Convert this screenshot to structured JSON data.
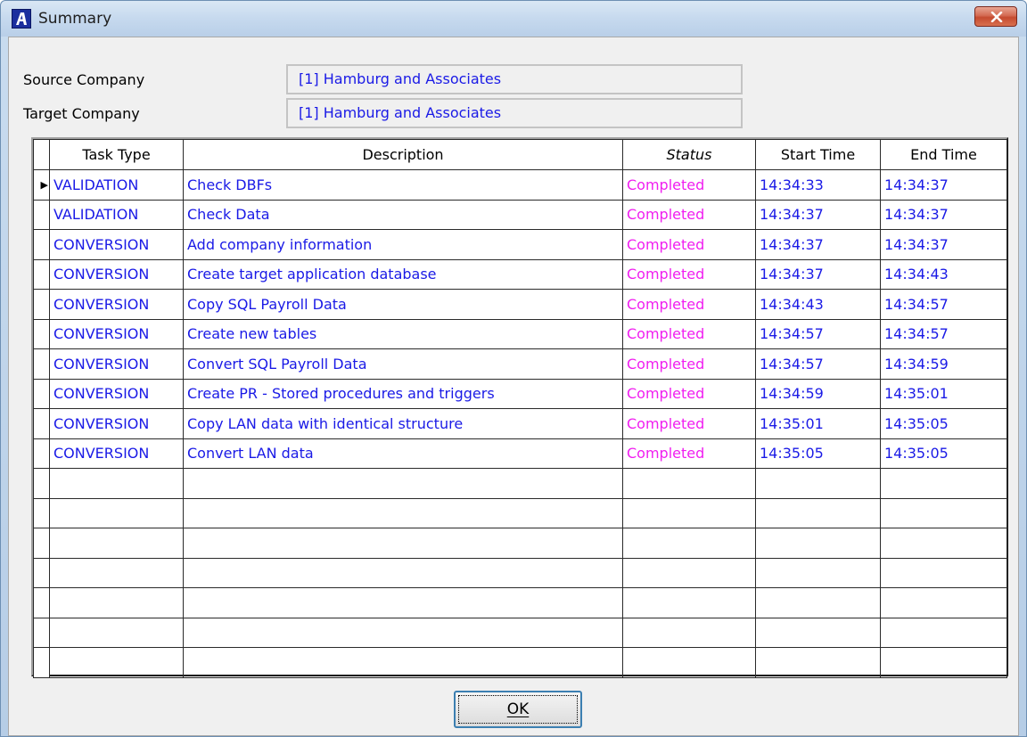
{
  "window": {
    "title": "Summary",
    "app_icon": "A"
  },
  "fields": {
    "source_label": "Source Company",
    "source_value": "[1] Hamburg and Associates",
    "target_label": "Target Company",
    "target_value": "[1] Hamburg and Associates"
  },
  "grid": {
    "headers": [
      "Task Type",
      "Description",
      "Status",
      "Start Time",
      "End Time"
    ],
    "rows": [
      {
        "type": "VALIDATION",
        "desc": "Check DBFs",
        "status": "Completed",
        "start": "14:34:33",
        "end": "14:34:37"
      },
      {
        "type": "VALIDATION",
        "desc": "Check Data",
        "status": "Completed",
        "start": "14:34:37",
        "end": "14:34:37"
      },
      {
        "type": "CONVERSION",
        "desc": "Add company information",
        "status": "Completed",
        "start": "14:34:37",
        "end": "14:34:37"
      },
      {
        "type": "CONVERSION",
        "desc": "Create target application database",
        "status": "Completed",
        "start": "14:34:37",
        "end": "14:34:43"
      },
      {
        "type": "CONVERSION",
        "desc": "Copy SQL Payroll Data",
        "status": "Completed",
        "start": "14:34:43",
        "end": "14:34:57"
      },
      {
        "type": "CONVERSION",
        "desc": "Create new tables",
        "status": "Completed",
        "start": "14:34:57",
        "end": "14:34:57"
      },
      {
        "type": "CONVERSION",
        "desc": "Convert SQL Payroll Data",
        "status": "Completed",
        "start": "14:34:57",
        "end": "14:34:59"
      },
      {
        "type": "CONVERSION",
        "desc": "Create PR - Stored procedures and triggers",
        "status": "Completed",
        "start": "14:34:59",
        "end": "14:35:01"
      },
      {
        "type": "CONVERSION",
        "desc": "Copy LAN data with identical structure",
        "status": "Completed",
        "start": "14:35:01",
        "end": "14:35:05"
      },
      {
        "type": "CONVERSION",
        "desc": "Convert LAN data",
        "status": "Completed",
        "start": "14:35:05",
        "end": "14:35:05"
      }
    ],
    "empty_rows": 7,
    "selected_row": 0
  },
  "buttons": {
    "ok_label": "OK"
  },
  "colors": {
    "value_text": "#1a1ae6",
    "status_text": "#f01ef0"
  },
  "icons": {
    "close": "close-icon",
    "row_pointer": "row-pointer-icon",
    "app": "app-icon"
  }
}
